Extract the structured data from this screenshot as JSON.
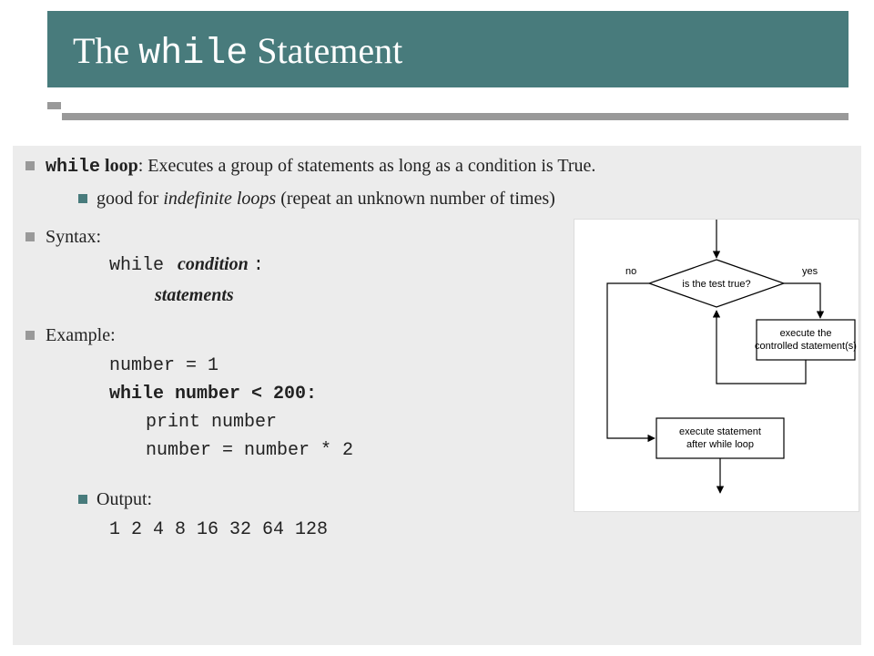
{
  "title_prefix": "The ",
  "title_kw": "while",
  "title_suffix": " Statement",
  "bullet1_a": "while",
  "bullet1_b": " loop",
  "bullet1_c": ": Executes a group of statements as long as a condition is True.",
  "bullet1_sub_a": "good for ",
  "bullet1_sub_b": "indefinite loops",
  "bullet1_sub_c": " (repeat an unknown number of times)",
  "syntax_label": "Syntax:",
  "syntax_kw": "while",
  "syntax_cond": "condition",
  "syntax_colon": ":",
  "syntax_stmts": "statements",
  "example_label": "Example:",
  "code_l1": "number = 1",
  "code_l2": "while number < 200:",
  "code_l3": "print number",
  "code_l4": "number = number * 2",
  "output_label": "Output:",
  "output_text": "1 2 4 8 16 32 64 128",
  "flow": {
    "no": "no",
    "yes": "yes",
    "test": "is the test true?",
    "exec1a": "execute the",
    "exec1b": "controlled statement(s)",
    "exec2a": "execute statement",
    "exec2b": "after while loop"
  }
}
